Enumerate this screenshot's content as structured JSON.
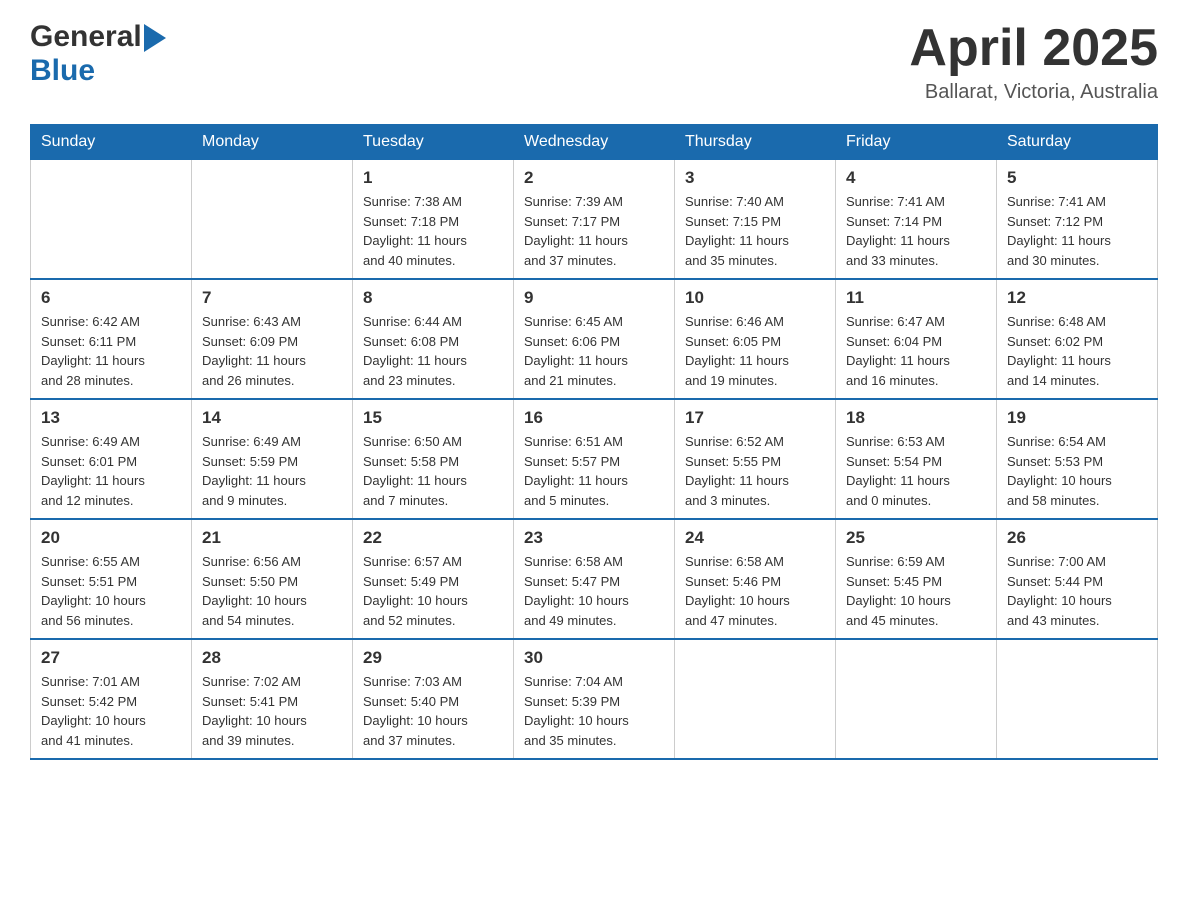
{
  "header": {
    "title": "April 2025",
    "location": "Ballarat, Victoria, Australia",
    "logo_general": "General",
    "logo_blue": "Blue"
  },
  "columns": [
    "Sunday",
    "Monday",
    "Tuesday",
    "Wednesday",
    "Thursday",
    "Friday",
    "Saturday"
  ],
  "weeks": [
    [
      {
        "day": "",
        "info": ""
      },
      {
        "day": "",
        "info": ""
      },
      {
        "day": "1",
        "info": "Sunrise: 7:38 AM\nSunset: 7:18 PM\nDaylight: 11 hours\nand 40 minutes."
      },
      {
        "day": "2",
        "info": "Sunrise: 7:39 AM\nSunset: 7:17 PM\nDaylight: 11 hours\nand 37 minutes."
      },
      {
        "day": "3",
        "info": "Sunrise: 7:40 AM\nSunset: 7:15 PM\nDaylight: 11 hours\nand 35 minutes."
      },
      {
        "day": "4",
        "info": "Sunrise: 7:41 AM\nSunset: 7:14 PM\nDaylight: 11 hours\nand 33 minutes."
      },
      {
        "day": "5",
        "info": "Sunrise: 7:41 AM\nSunset: 7:12 PM\nDaylight: 11 hours\nand 30 minutes."
      }
    ],
    [
      {
        "day": "6",
        "info": "Sunrise: 6:42 AM\nSunset: 6:11 PM\nDaylight: 11 hours\nand 28 minutes."
      },
      {
        "day": "7",
        "info": "Sunrise: 6:43 AM\nSunset: 6:09 PM\nDaylight: 11 hours\nand 26 minutes."
      },
      {
        "day": "8",
        "info": "Sunrise: 6:44 AM\nSunset: 6:08 PM\nDaylight: 11 hours\nand 23 minutes."
      },
      {
        "day": "9",
        "info": "Sunrise: 6:45 AM\nSunset: 6:06 PM\nDaylight: 11 hours\nand 21 minutes."
      },
      {
        "day": "10",
        "info": "Sunrise: 6:46 AM\nSunset: 6:05 PM\nDaylight: 11 hours\nand 19 minutes."
      },
      {
        "day": "11",
        "info": "Sunrise: 6:47 AM\nSunset: 6:04 PM\nDaylight: 11 hours\nand 16 minutes."
      },
      {
        "day": "12",
        "info": "Sunrise: 6:48 AM\nSunset: 6:02 PM\nDaylight: 11 hours\nand 14 minutes."
      }
    ],
    [
      {
        "day": "13",
        "info": "Sunrise: 6:49 AM\nSunset: 6:01 PM\nDaylight: 11 hours\nand 12 minutes."
      },
      {
        "day": "14",
        "info": "Sunrise: 6:49 AM\nSunset: 5:59 PM\nDaylight: 11 hours\nand 9 minutes."
      },
      {
        "day": "15",
        "info": "Sunrise: 6:50 AM\nSunset: 5:58 PM\nDaylight: 11 hours\nand 7 minutes."
      },
      {
        "day": "16",
        "info": "Sunrise: 6:51 AM\nSunset: 5:57 PM\nDaylight: 11 hours\nand 5 minutes."
      },
      {
        "day": "17",
        "info": "Sunrise: 6:52 AM\nSunset: 5:55 PM\nDaylight: 11 hours\nand 3 minutes."
      },
      {
        "day": "18",
        "info": "Sunrise: 6:53 AM\nSunset: 5:54 PM\nDaylight: 11 hours\nand 0 minutes."
      },
      {
        "day": "19",
        "info": "Sunrise: 6:54 AM\nSunset: 5:53 PM\nDaylight: 10 hours\nand 58 minutes."
      }
    ],
    [
      {
        "day": "20",
        "info": "Sunrise: 6:55 AM\nSunset: 5:51 PM\nDaylight: 10 hours\nand 56 minutes."
      },
      {
        "day": "21",
        "info": "Sunrise: 6:56 AM\nSunset: 5:50 PM\nDaylight: 10 hours\nand 54 minutes."
      },
      {
        "day": "22",
        "info": "Sunrise: 6:57 AM\nSunset: 5:49 PM\nDaylight: 10 hours\nand 52 minutes."
      },
      {
        "day": "23",
        "info": "Sunrise: 6:58 AM\nSunset: 5:47 PM\nDaylight: 10 hours\nand 49 minutes."
      },
      {
        "day": "24",
        "info": "Sunrise: 6:58 AM\nSunset: 5:46 PM\nDaylight: 10 hours\nand 47 minutes."
      },
      {
        "day": "25",
        "info": "Sunrise: 6:59 AM\nSunset: 5:45 PM\nDaylight: 10 hours\nand 45 minutes."
      },
      {
        "day": "26",
        "info": "Sunrise: 7:00 AM\nSunset: 5:44 PM\nDaylight: 10 hours\nand 43 minutes."
      }
    ],
    [
      {
        "day": "27",
        "info": "Sunrise: 7:01 AM\nSunset: 5:42 PM\nDaylight: 10 hours\nand 41 minutes."
      },
      {
        "day": "28",
        "info": "Sunrise: 7:02 AM\nSunset: 5:41 PM\nDaylight: 10 hours\nand 39 minutes."
      },
      {
        "day": "29",
        "info": "Sunrise: 7:03 AM\nSunset: 5:40 PM\nDaylight: 10 hours\nand 37 minutes."
      },
      {
        "day": "30",
        "info": "Sunrise: 7:04 AM\nSunset: 5:39 PM\nDaylight: 10 hours\nand 35 minutes."
      },
      {
        "day": "",
        "info": ""
      },
      {
        "day": "",
        "info": ""
      },
      {
        "day": "",
        "info": ""
      }
    ]
  ]
}
